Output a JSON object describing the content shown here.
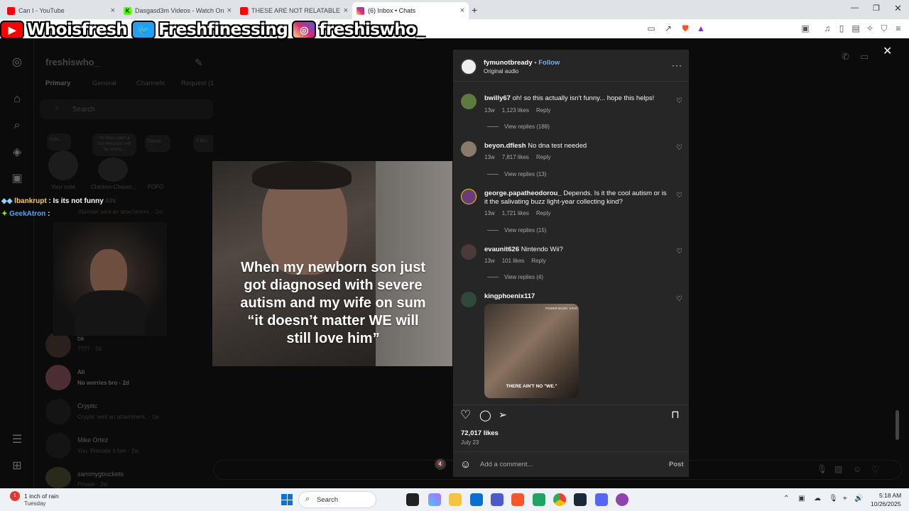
{
  "browser": {
    "tabs": [
      {
        "title": "Can I - YouTube",
        "active": false,
        "icon": "youtube-icon"
      },
      {
        "title": "Dasgasd3m Videos - Watch On-Dem",
        "active": false,
        "icon": "kick-icon"
      },
      {
        "title": "THESE ARE NOT RELATABLE MEMES",
        "active": false,
        "icon": "youtube-icon"
      },
      {
        "title": "(6) Inbox • Chats",
        "active": true,
        "icon": "instagram-icon"
      }
    ]
  },
  "banner": {
    "youtube": "Whoisfresh",
    "twitter": "Freshfinessing",
    "instagram": "freshiswho_"
  },
  "dm": {
    "account": "freshiswho_",
    "tabs": [
      "Primary",
      "General",
      "Channels",
      "Request (1"
    ],
    "search_placeholder": "Search",
    "notes": [
      {
        "text": "Note...",
        "label": "Your note"
      },
      {
        "text": "I'm finna catch a rico because i will be wrong...",
        "label": "Chicken-Chaser..."
      },
      {
        "text": "Damn",
        "label": "FOFO"
      },
      {
        "text": "lil Bra",
        "label": ""
      }
    ],
    "threads": [
      {
        "name": "bk",
        "preview": "???? · 2d"
      },
      {
        "name": "Ali",
        "preview": "No worries bro · 2d"
      },
      {
        "name": "Cryptic",
        "preview": "Cryptic sent an attachment. · 1w"
      },
      {
        "name": "Mike Ortez",
        "preview": "You: Preciate it fam · 2w"
      },
      {
        "name": "sammygbuckets",
        "preview": "Private · 2w"
      }
    ],
    "partial_thread": {
      "name": "AIN",
      "preview": "Abimael sent an attachment. · 1m"
    }
  },
  "chat_overlay": [
    {
      "user": "lbankrupt",
      "msg": "Is its not funny"
    },
    {
      "user": "GeekAtron",
      "msg": ""
    }
  ],
  "video": {
    "caption": "When my newborn son just got diagnosed with severe autism and my wife on sum “it doesn’t matter WE will still love him”"
  },
  "post": {
    "author": "fymunotbready",
    "follow": "Follow",
    "audio": "Original audio",
    "comments": [
      {
        "user": "bwilly67",
        "text": "oh! so this actually isn't funny... hope this helps!",
        "age": "13w",
        "likes": "1,123 likes",
        "reply": "Reply",
        "replies": "View replies (188)"
      },
      {
        "user": "beyon.dflesh",
        "text": "No dna test needed",
        "age": "13w",
        "likes": "7,817 likes",
        "reply": "Reply",
        "replies": "View replies (13)"
      },
      {
        "user": "george.papatheodorou_",
        "text": "Depends. Is it the cool autism or is it the salivating buzz light-year collecting kind?",
        "age": "13w",
        "likes": "1,721 likes",
        "reply": "Reply",
        "replies": "View replies (15)"
      },
      {
        "user": "evaunit626",
        "text": "Nintendo Wii?",
        "age": "13w",
        "likes": "101 likes",
        "reply": "Reply",
        "replies": "View replies (4)"
      },
      {
        "user": "kingphoenix117",
        "text": "",
        "age": "",
        "likes": "",
        "reply": "",
        "replies": ""
      }
    ],
    "gif_caption": "THERE AIN'T NO \"WE.\"",
    "gif_tag": "POWER BOOK: STAR",
    "likes": "72,017 likes",
    "date": "July 23",
    "comment_placeholder": "Add a comment...",
    "post_button": "Post"
  },
  "taskbar": {
    "weather_temp": "1 inch of rain",
    "weather_day": "Tuesday",
    "search": "Search",
    "time": "5:18 AM",
    "date": "10/26/2025"
  },
  "colors": {
    "accent": "#0095f6",
    "panel": "#262626",
    "chrome": "#dfe3e8"
  }
}
